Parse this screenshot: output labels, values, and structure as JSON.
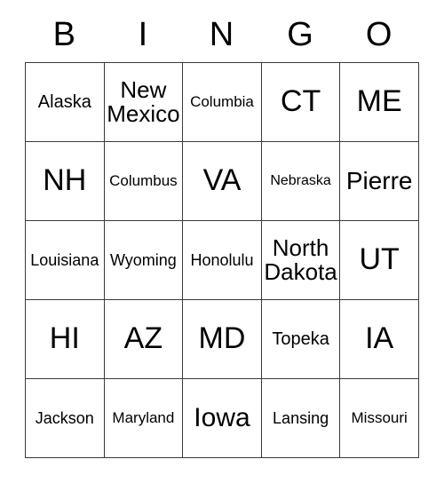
{
  "card": {
    "header_letters": [
      "B",
      "I",
      "N",
      "G",
      "O"
    ],
    "rows": [
      [
        {
          "text": "Alaska",
          "size": "fs-l"
        },
        {
          "text": "New Mexico",
          "size": "fs-xl"
        },
        {
          "text": "Columbia",
          "size": "fs-s"
        },
        {
          "text": "CT",
          "size": "fs-4xl"
        },
        {
          "text": "ME",
          "size": "fs-4xl"
        }
      ],
      [
        {
          "text": "NH",
          "size": "fs-4xl"
        },
        {
          "text": "Columbus",
          "size": "fs-s"
        },
        {
          "text": "VA",
          "size": "fs-4xl"
        },
        {
          "text": "Nebraska",
          "size": "fs-xs"
        },
        {
          "text": "Pierre",
          "size": "fs-2xl"
        }
      ],
      [
        {
          "text": "Louisiana",
          "size": "fs-m"
        },
        {
          "text": "Wyoming",
          "size": "fs-m"
        },
        {
          "text": "Honolulu",
          "size": "fs-m"
        },
        {
          "text": "North Dakota",
          "size": "fs-xl"
        },
        {
          "text": "UT",
          "size": "fs-4xl"
        }
      ],
      [
        {
          "text": "HI",
          "size": "fs-4xl"
        },
        {
          "text": "AZ",
          "size": "fs-4xl"
        },
        {
          "text": "MD",
          "size": "fs-4xl"
        },
        {
          "text": "Topeka",
          "size": "fs-l"
        },
        {
          "text": "IA",
          "size": "fs-4xl"
        }
      ],
      [
        {
          "text": "Jackson",
          "size": "fs-m"
        },
        {
          "text": "Maryland",
          "size": "fs-s"
        },
        {
          "text": "Iowa",
          "size": "fs-3xl"
        },
        {
          "text": "Lansing",
          "size": "fs-m"
        },
        {
          "text": "Missouri",
          "size": "fs-s"
        }
      ]
    ]
  }
}
